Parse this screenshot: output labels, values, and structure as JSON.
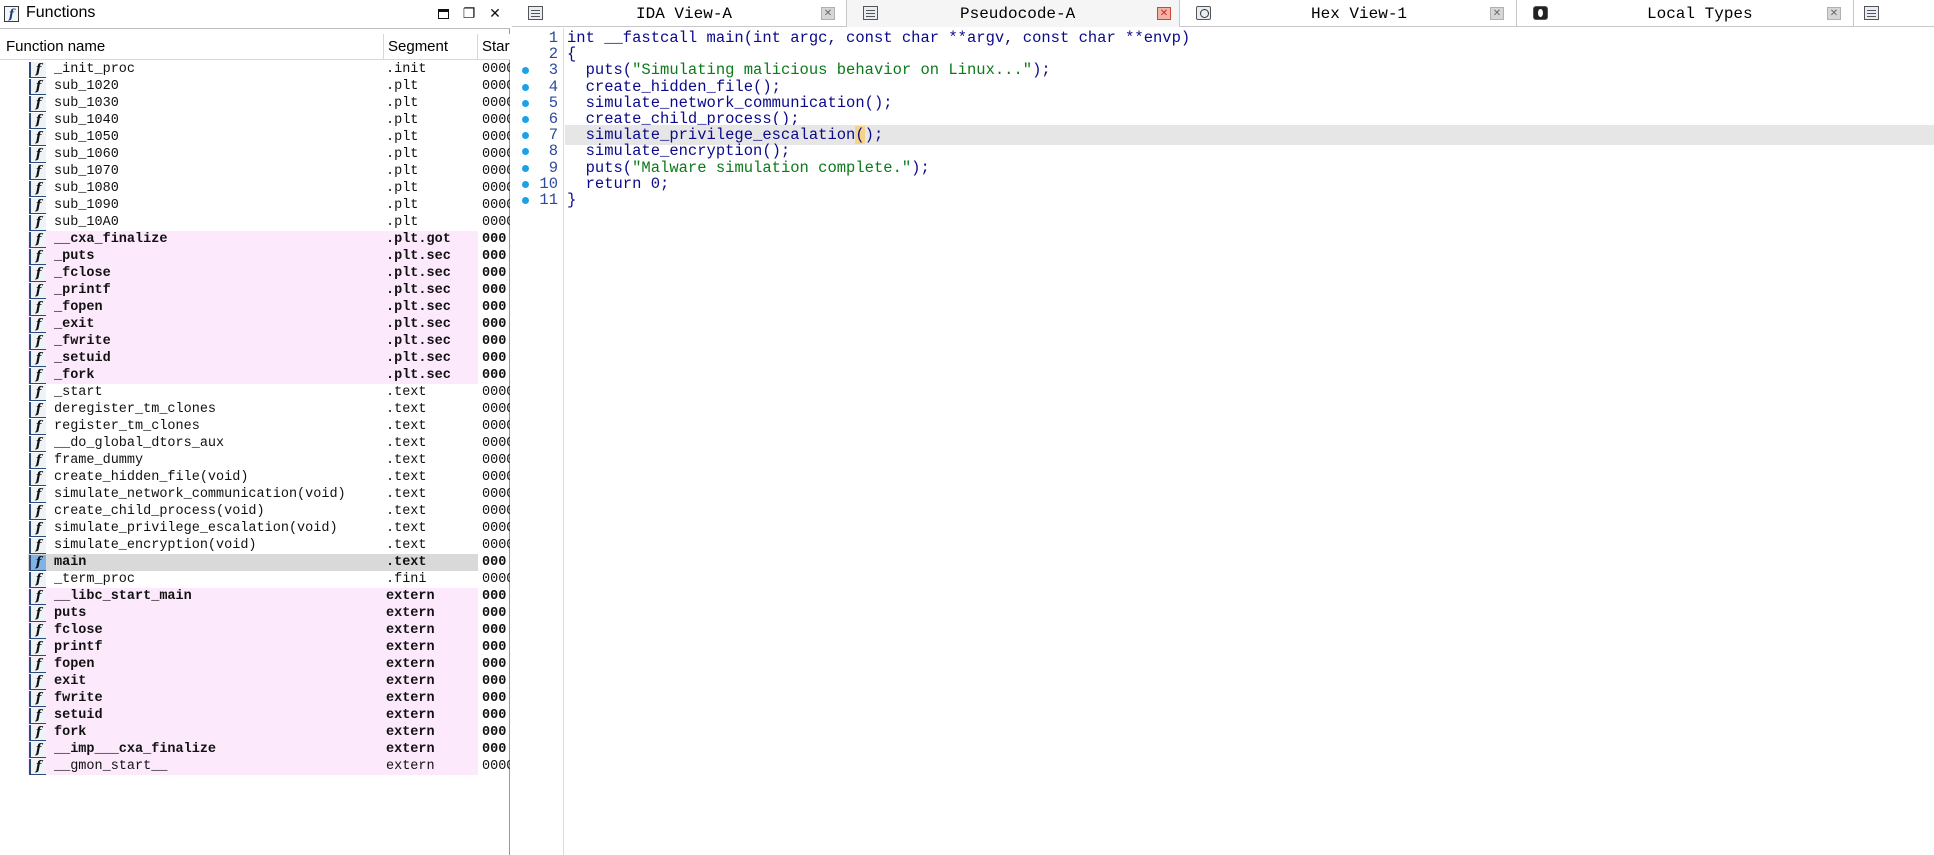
{
  "functions_panel": {
    "title": "Functions",
    "columns": {
      "name": "Function name",
      "segment": "Segment",
      "start": "Start"
    },
    "rows": [
      {
        "name": "_init_proc",
        "segment": ".init",
        "start": "0000",
        "style": "normal"
      },
      {
        "name": "sub_1020",
        "segment": ".plt",
        "start": "0000",
        "style": "normal"
      },
      {
        "name": "sub_1030",
        "segment": ".plt",
        "start": "0000",
        "style": "normal"
      },
      {
        "name": "sub_1040",
        "segment": ".plt",
        "start": "0000",
        "style": "normal"
      },
      {
        "name": "sub_1050",
        "segment": ".plt",
        "start": "0000",
        "style": "normal"
      },
      {
        "name": "sub_1060",
        "segment": ".plt",
        "start": "0000",
        "style": "normal"
      },
      {
        "name": "sub_1070",
        "segment": ".plt",
        "start": "0000",
        "style": "normal"
      },
      {
        "name": "sub_1080",
        "segment": ".plt",
        "start": "0000",
        "style": "normal"
      },
      {
        "name": "sub_1090",
        "segment": ".plt",
        "start": "0000",
        "style": "normal"
      },
      {
        "name": "sub_10A0",
        "segment": ".plt",
        "start": "0000",
        "style": "normal"
      },
      {
        "name": "__cxa_finalize",
        "segment": ".plt.got",
        "start": "000",
        "style": "imported"
      },
      {
        "name": "_puts",
        "segment": ".plt.sec",
        "start": "000",
        "style": "imported"
      },
      {
        "name": "_fclose",
        "segment": ".plt.sec",
        "start": "000",
        "style": "imported"
      },
      {
        "name": "_printf",
        "segment": ".plt.sec",
        "start": "000",
        "style": "imported"
      },
      {
        "name": "_fopen",
        "segment": ".plt.sec",
        "start": "000",
        "style": "imported"
      },
      {
        "name": "_exit",
        "segment": ".plt.sec",
        "start": "000",
        "style": "imported"
      },
      {
        "name": "_fwrite",
        "segment": ".plt.sec",
        "start": "000",
        "style": "imported"
      },
      {
        "name": "_setuid",
        "segment": ".plt.sec",
        "start": "000",
        "style": "imported"
      },
      {
        "name": "_fork",
        "segment": ".plt.sec",
        "start": "000",
        "style": "imported"
      },
      {
        "name": "_start",
        "segment": ".text",
        "start": "0000",
        "style": "normal"
      },
      {
        "name": "deregister_tm_clones",
        "segment": ".text",
        "start": "0000",
        "style": "normal"
      },
      {
        "name": "register_tm_clones",
        "segment": ".text",
        "start": "0000",
        "style": "normal"
      },
      {
        "name": "__do_global_dtors_aux",
        "segment": ".text",
        "start": "0000",
        "style": "normal"
      },
      {
        "name": "frame_dummy",
        "segment": ".text",
        "start": "0000",
        "style": "normal"
      },
      {
        "name": "create_hidden_file(void)",
        "segment": ".text",
        "start": "0000",
        "style": "normal"
      },
      {
        "name": "simulate_network_communication(void)",
        "segment": ".text",
        "start": "0000",
        "style": "normal"
      },
      {
        "name": "create_child_process(void)",
        "segment": ".text",
        "start": "0000",
        "style": "normal"
      },
      {
        "name": "simulate_privilege_escalation(void)",
        "segment": ".text",
        "start": "0000",
        "style": "normal"
      },
      {
        "name": "simulate_encryption(void)",
        "segment": ".text",
        "start": "0000",
        "style": "normal"
      },
      {
        "name": "main",
        "segment": ".text",
        "start": "000",
        "style": "selected"
      },
      {
        "name": "_term_proc",
        "segment": ".fini",
        "start": "0000",
        "style": "normal"
      },
      {
        "name": "__libc_start_main",
        "segment": "extern",
        "start": "000",
        "style": "imported"
      },
      {
        "name": "puts",
        "segment": "extern",
        "start": "000",
        "style": "imported"
      },
      {
        "name": "fclose",
        "segment": "extern",
        "start": "000",
        "style": "imported"
      },
      {
        "name": "printf",
        "segment": "extern",
        "start": "000",
        "style": "imported"
      },
      {
        "name": "fopen",
        "segment": "extern",
        "start": "000",
        "style": "imported"
      },
      {
        "name": "exit",
        "segment": "extern",
        "start": "000",
        "style": "imported"
      },
      {
        "name": "fwrite",
        "segment": "extern",
        "start": "000",
        "style": "imported"
      },
      {
        "name": "setuid",
        "segment": "extern",
        "start": "000",
        "style": "imported"
      },
      {
        "name": "fork",
        "segment": "extern",
        "start": "000",
        "style": "imported"
      },
      {
        "name": "__imp___cxa_finalize",
        "segment": "extern",
        "start": "000",
        "style": "imported"
      },
      {
        "name": "__gmon_start__",
        "segment": "extern",
        "start": "0000",
        "style": "imported-light"
      }
    ]
  },
  "tabs": [
    {
      "label": "IDA View-A",
      "icon": "listing-icon",
      "active": false
    },
    {
      "label": "Pseudocode-A",
      "icon": "pseudocode-icon",
      "active": true
    },
    {
      "label": "Hex View-1",
      "icon": "hex-view-icon",
      "active": false
    },
    {
      "label": "Local Types",
      "icon": "local-types-icon",
      "active": false
    }
  ],
  "pseudocode": {
    "lines": [
      {
        "no": "1",
        "bp": false,
        "tokens": [
          {
            "t": "int __fastcall main(int argc, const char **argv, const char **envp)"
          }
        ]
      },
      {
        "no": "2",
        "bp": false,
        "tokens": [
          {
            "t": "{"
          }
        ]
      },
      {
        "no": "3",
        "bp": true,
        "tokens": [
          {
            "t": "  puts("
          },
          {
            "t": "\"Simulating malicious behavior on Linux...\"",
            "c": "str"
          },
          {
            "t": ");"
          }
        ]
      },
      {
        "no": "4",
        "bp": true,
        "tokens": [
          {
            "t": "  create_hidden_file();"
          }
        ]
      },
      {
        "no": "5",
        "bp": true,
        "tokens": [
          {
            "t": "  simulate_network_communication();"
          }
        ]
      },
      {
        "no": "6",
        "bp": true,
        "tokens": [
          {
            "t": "  create_child_process();"
          }
        ]
      },
      {
        "no": "7",
        "bp": true,
        "current": true,
        "tokens": [
          {
            "t": "  simulate_privilege_escalation"
          },
          {
            "t": "(",
            "c": "hl"
          },
          {
            "t": ");"
          }
        ]
      },
      {
        "no": "8",
        "bp": true,
        "tokens": [
          {
            "t": "  simulate_encryption();"
          }
        ]
      },
      {
        "no": "9",
        "bp": true,
        "tokens": [
          {
            "t": "  puts("
          },
          {
            "t": "\"Malware simulation complete.\"",
            "c": "str"
          },
          {
            "t": ");"
          }
        ]
      },
      {
        "no": "10",
        "bp": true,
        "tokens": [
          {
            "t": "  return 0;"
          }
        ]
      },
      {
        "no": "11",
        "bp": true,
        "tokens": [
          {
            "t": "}"
          }
        ]
      }
    ]
  }
}
